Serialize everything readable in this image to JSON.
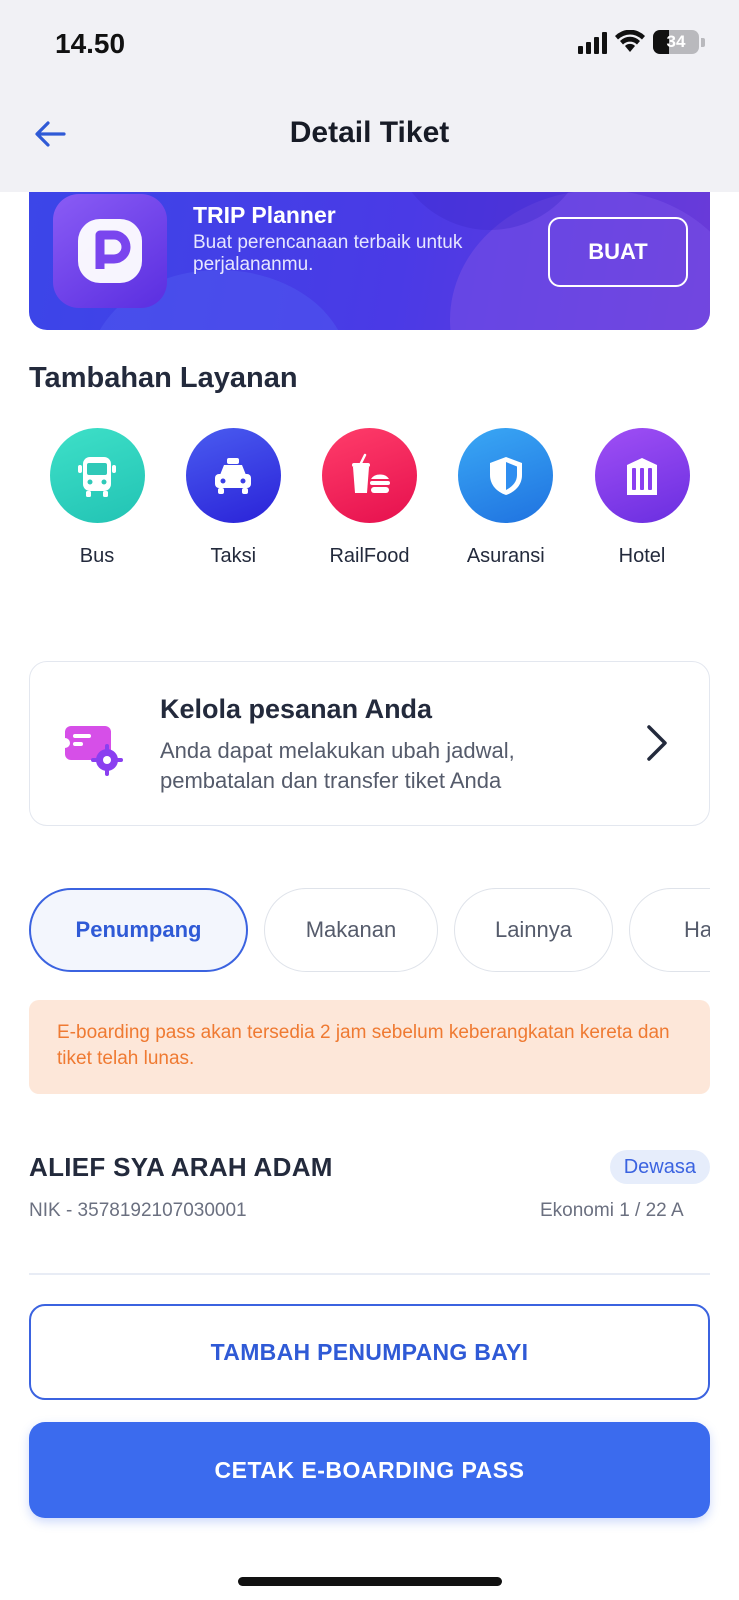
{
  "status_bar": {
    "time": "14.50",
    "battery": "34"
  },
  "header": {
    "title": "Detail Tiket",
    "back_icon": "arrow-left-icon"
  },
  "banner": {
    "title": "TRIP Planner",
    "description": "Buat perencanaan terbaik untuk perjalananmu.",
    "button_label": "BUAT"
  },
  "services": {
    "title": "Tambahan Layanan",
    "items": [
      {
        "label": "Bus",
        "icon": "bus-icon",
        "color": "#2fd3c0"
      },
      {
        "label": "Taksi",
        "icon": "taxi-icon",
        "color": "#3b3fe6"
      },
      {
        "label": "RailFood",
        "icon": "food-icon",
        "color": "#f0245e"
      },
      {
        "label": "Asuransi",
        "icon": "shield-icon",
        "color": "#2f8ef0"
      },
      {
        "label": "Hotel",
        "icon": "hotel-icon",
        "color": "#8a3ff0"
      }
    ]
  },
  "manage": {
    "title": "Kelola pesanan Anda",
    "description": "Anda dapat melakukan ubah jadwal, pembatalan dan transfer tiket Anda"
  },
  "tabs": [
    "Penumpang",
    "Makanan",
    "Lainnya",
    "Harga"
  ],
  "notice": "E-boarding pass akan tersedia 2 jam sebelum keberangkatan kereta dan tiket telah lunas.",
  "passenger": {
    "name": "ALIEF SYA ARAH ADAM",
    "type": "Dewasa",
    "nik": "NIK - 3578192107030001",
    "seat": "Ekonomi 1 / 22 A"
  },
  "buttons": {
    "add_infant": "TAMBAH PENUMPANG BAYI",
    "print_pass": "CETAK E-BOARDING PASS"
  },
  "colors": {
    "primary": "#3b6bee",
    "accent": "#2f5ad6",
    "notice_bg": "#fde7d9",
    "notice_text": "#ef7a32"
  }
}
